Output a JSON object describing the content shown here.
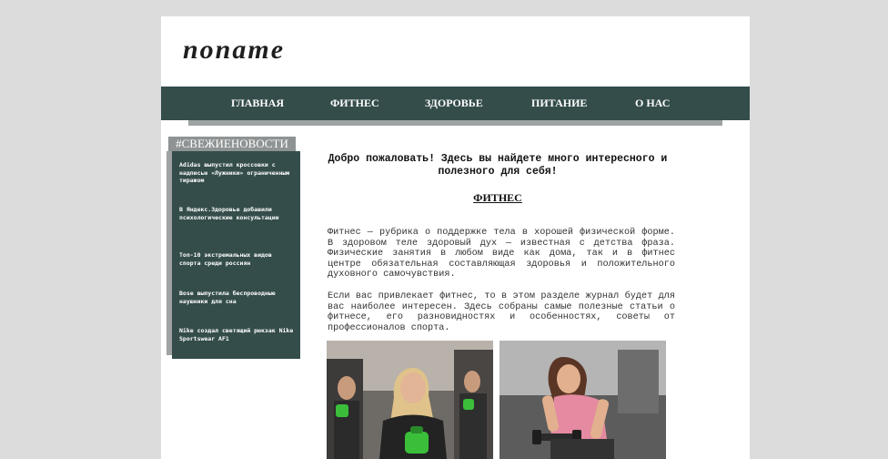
{
  "site": {
    "logo": "noname"
  },
  "nav": {
    "items": [
      {
        "label": "ГЛАВНАЯ"
      },
      {
        "label": "ФИТНЕС"
      },
      {
        "label": "ЗДОРОВЬЕ"
      },
      {
        "label": "ПИТАНИЕ"
      },
      {
        "label": "О НАС"
      }
    ]
  },
  "sidebar": {
    "title": "#СВЕЖИЕНОВОСТИ",
    "items": [
      {
        "text": "Adidas выпустил кроссовки с надписью «Лужники» ограниченным тиражом"
      },
      {
        "text": "В Яндекс.Здоровье добавили психологические консультации"
      },
      {
        "text": "Топ-10 экстремальных видов спорта среди россиян"
      },
      {
        "text": "Bose выпустила беспроводные наушники для сна"
      },
      {
        "text": "Nike создал светящий рюкзак Nike Sportswear AF1"
      }
    ]
  },
  "main": {
    "welcome": "Добро пожаловать! Здесь вы найдете много интересного и полезного для себя!",
    "section_title": "ФИТНЕС",
    "paragraphs": [
      "Фитнес — рубрика о поддержке тела в хорошей физической форме. В здоровом теле здоровый дух — известная с детства фраза. Физические занятия в любом виде как дома, так и в фитнес центре обязательная составляющая здоровья и положительного духовного самочувствия.",
      "Если вас привлекает фитнес, то в этом разделе журнал будет для вас наиболее интересен. Здесь собраны самые полезные статьи о фитнесе, его разновидностях и особенностях, советы от профессионалов спорта."
    ]
  },
  "colors": {
    "nav_bg": "#344d4b",
    "page_bg": "#dcdcdc",
    "sidebar_title_bg": "#8f9393"
  }
}
